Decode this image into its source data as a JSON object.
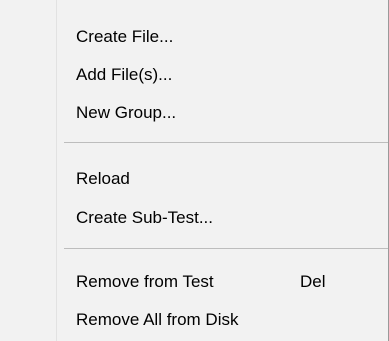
{
  "menu": {
    "items": [
      {
        "label": "Create File..."
      },
      {
        "label": "Add File(s)..."
      },
      {
        "label": "New Group..."
      },
      {
        "label": "Reload"
      },
      {
        "label": "Create Sub-Test..."
      },
      {
        "label": "Remove from Test",
        "shortcut": "Del"
      },
      {
        "label": "Remove All from Disk"
      }
    ]
  }
}
